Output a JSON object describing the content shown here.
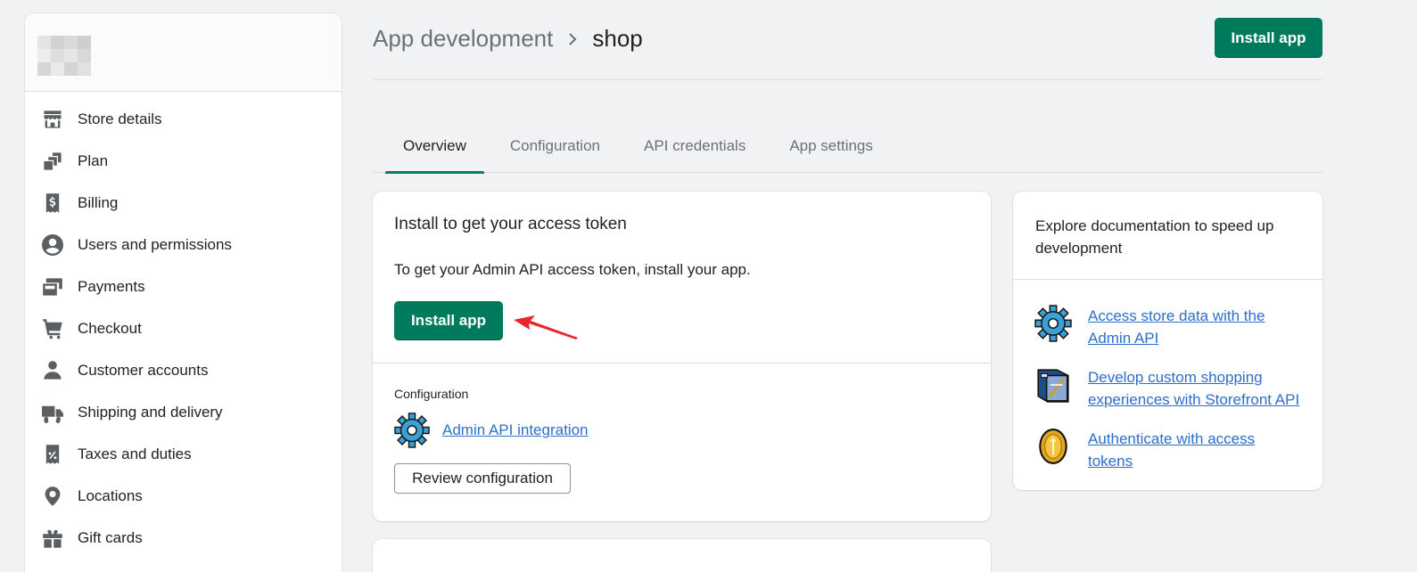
{
  "sidebar": {
    "items": [
      {
        "label": "Store details",
        "icon": "store-icon"
      },
      {
        "label": "Plan",
        "icon": "plan-icon"
      },
      {
        "label": "Billing",
        "icon": "billing-icon"
      },
      {
        "label": "Users and permissions",
        "icon": "user-circle-icon"
      },
      {
        "label": "Payments",
        "icon": "payments-icon"
      },
      {
        "label": "Checkout",
        "icon": "cart-icon"
      },
      {
        "label": "Customer accounts",
        "icon": "customer-icon"
      },
      {
        "label": "Shipping and delivery",
        "icon": "truck-icon"
      },
      {
        "label": "Taxes and duties",
        "icon": "tax-receipt-icon"
      },
      {
        "label": "Locations",
        "icon": "location-pin-icon"
      },
      {
        "label": "Gift cards",
        "icon": "gift-icon"
      }
    ]
  },
  "header": {
    "breadcrumb_parent": "App development",
    "breadcrumb_current": "shop",
    "install_button": "Install app"
  },
  "tabs": [
    {
      "label": "Overview",
      "active": true
    },
    {
      "label": "Configuration",
      "active": false
    },
    {
      "label": "API credentials",
      "active": false
    },
    {
      "label": "App settings",
      "active": false
    }
  ],
  "main_card": {
    "title": "Install to get your access token",
    "text": "To get your Admin API access token, install your app.",
    "install_button": "Install app",
    "config_label": "Configuration",
    "config_link": "Admin API integration",
    "review_button": "Review configuration"
  },
  "side_card": {
    "title": "Explore documentation to speed up development",
    "links": [
      {
        "label": "Access store data with the Admin API",
        "icon": "gear-icon"
      },
      {
        "label": "Develop custom shopping experiences with Storefront API",
        "icon": "storefront-icon"
      },
      {
        "label": "Authenticate with access tokens",
        "icon": "coin-icon"
      }
    ]
  },
  "colors": {
    "primary": "#007a5c",
    "link": "#2c6ecb",
    "annotation_arrow": "#e8262c"
  }
}
